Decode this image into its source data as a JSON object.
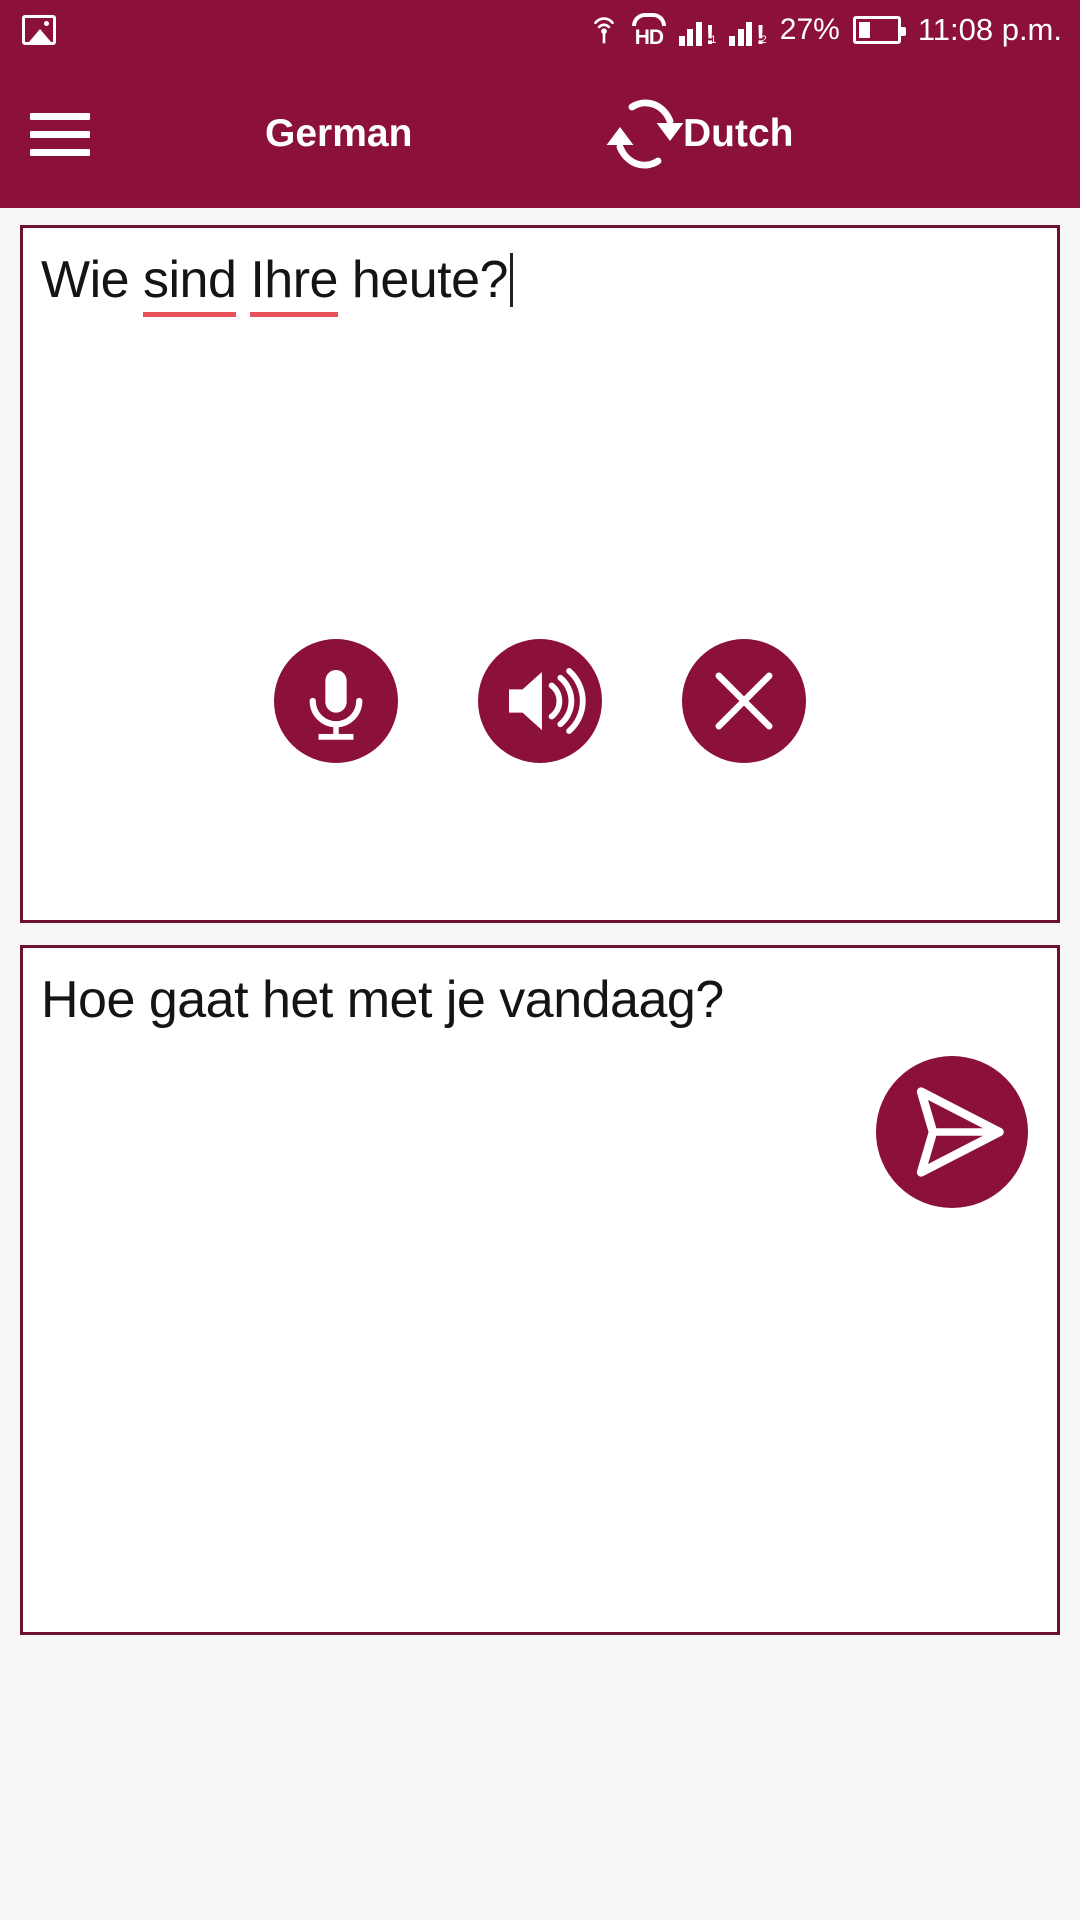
{
  "status_bar": {
    "notification_icon": "image-icon",
    "cast_icon": "cast-icon",
    "hd_label": "HD",
    "sim1_icon": "signal-bars-sim1",
    "sim2_icon": "signal-bars-sim2",
    "battery_percent": "27%",
    "battery_icon": "battery-icon",
    "time": "11:08 p.m."
  },
  "app_bar": {
    "menu_icon": "hamburger-menu-icon",
    "source_language": "German",
    "swap_icon": "swap-languages-icon",
    "target_language": "Dutch"
  },
  "source_panel": {
    "text_before": "Wie ",
    "misspelled_1": "sind",
    "text_mid": " ",
    "misspelled_2": "Ihre",
    "text_after": " heute?",
    "full_text": "Wie sind Ihre heute?"
  },
  "actions": {
    "mic_icon": "microphone-icon",
    "speak_icon": "speaker-volume-icon",
    "clear_icon": "close-clear-icon"
  },
  "target_panel": {
    "text": "Hoe gaat het met je vandaag?"
  },
  "send_button": {
    "icon": "send-paper-plane-icon"
  },
  "colors": {
    "brand": "#8b1139",
    "panel_border": "#6e1030",
    "spellcheck_underline": "#e8505b",
    "page_background": "#f7f7f7",
    "panel_background": "#ffffff",
    "text": "#141414"
  }
}
